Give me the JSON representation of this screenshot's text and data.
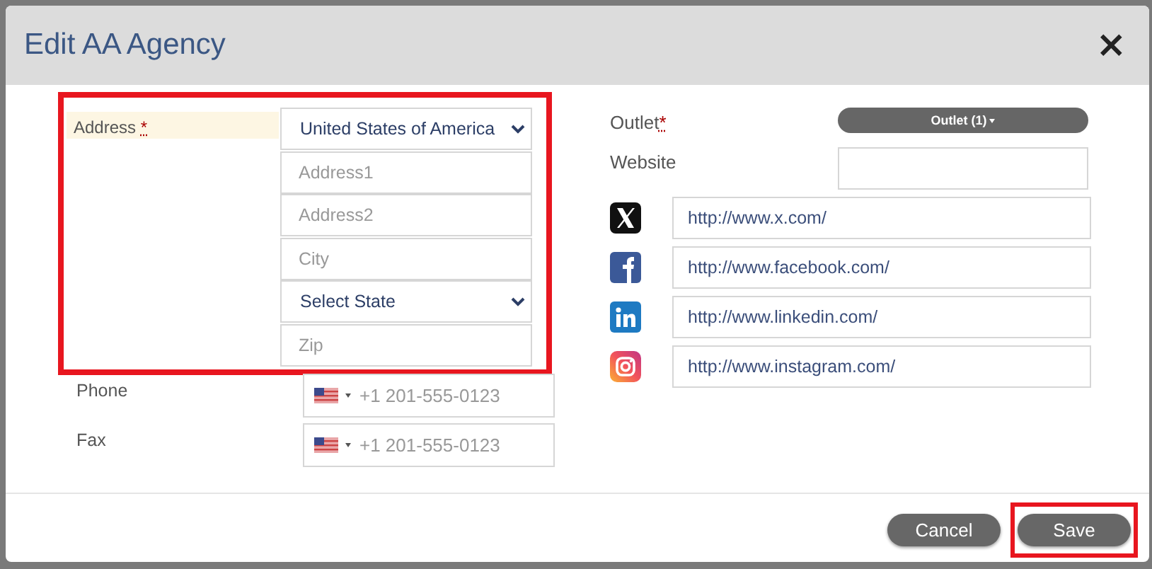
{
  "dialog": {
    "title": "Edit AA Agency",
    "close": "×"
  },
  "address": {
    "label": "Address",
    "required_mark": "*",
    "highlighted": true,
    "fields": [
      {
        "kind": "select",
        "value": "United States of America"
      },
      {
        "kind": "text",
        "placeholder": "Address1"
      },
      {
        "kind": "text",
        "placeholder": "Address2"
      },
      {
        "kind": "text",
        "placeholder": "City"
      },
      {
        "kind": "select",
        "value": "Select State"
      },
      {
        "kind": "text",
        "placeholder": "Zip"
      }
    ]
  },
  "phones": [
    {
      "label": "Phone",
      "placeholder": "+1 201-555-0123"
    },
    {
      "label": "Fax",
      "placeholder": "+1 201-555-0123"
    }
  ],
  "outlet": {
    "label": "Outlet",
    "required_mark": "*",
    "button": "Outlet (1)"
  },
  "website": {
    "label": "Website"
  },
  "social": [
    {
      "kind": "x",
      "value": "http://www.x.com/"
    },
    {
      "kind": "facebook",
      "value": "http://www.facebook.com/"
    },
    {
      "kind": "linkedin",
      "value": "http://www.linkedin.com/"
    },
    {
      "kind": "instagram",
      "value": "http://www.instagram.com/"
    }
  ],
  "footer": {
    "buttons": [
      {
        "label": "Cancel",
        "highlighted": false
      },
      {
        "label": "Save",
        "highlighted": true
      }
    ]
  }
}
